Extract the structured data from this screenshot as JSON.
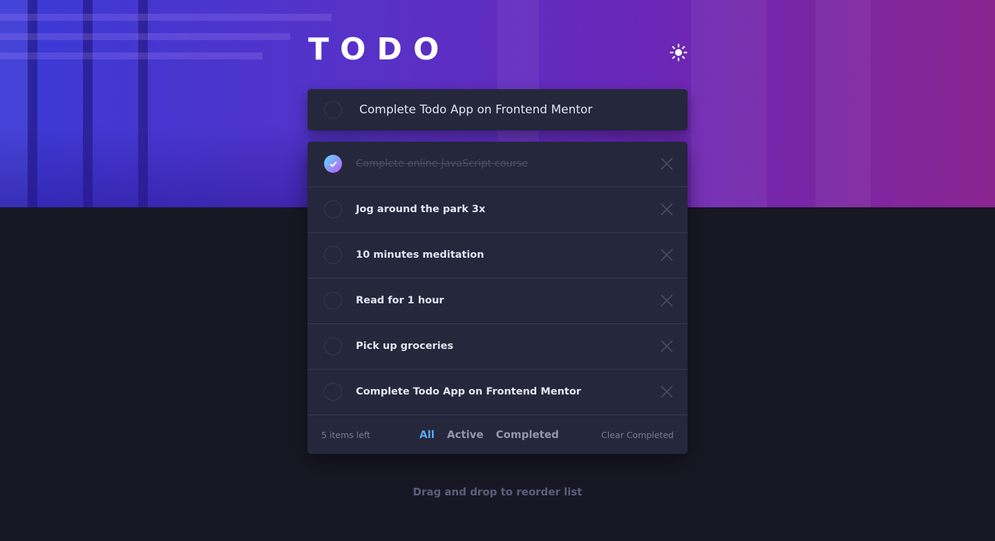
{
  "app": {
    "title": "TODO"
  },
  "theme_toggle": {
    "icon": "sun-icon"
  },
  "new_todo": {
    "value": "Complete Todo App on Frontend Mentor"
  },
  "todos": [
    {
      "text": "Complete online JavaScript course",
      "completed": true
    },
    {
      "text": "Jog around the park 3x",
      "completed": false
    },
    {
      "text": "10 minutes meditation",
      "completed": false
    },
    {
      "text": "Read for 1 hour",
      "completed": false
    },
    {
      "text": "Pick up groceries",
      "completed": false
    },
    {
      "text": "Complete Todo App on Frontend Mentor",
      "completed": false
    }
  ],
  "footer": {
    "items_left": "5 items left",
    "filters": [
      "All",
      "Active",
      "Completed"
    ],
    "active_filter": "All",
    "clear_label": "Clear Completed"
  },
  "hint": "Drag and drop to reorder list",
  "colors": {
    "background": "#181824",
    "card": "#25273c",
    "accent_blue": "#5aa8f0",
    "check_gradient_start": "#57ddff",
    "check_gradient_end": "#c058f3"
  }
}
